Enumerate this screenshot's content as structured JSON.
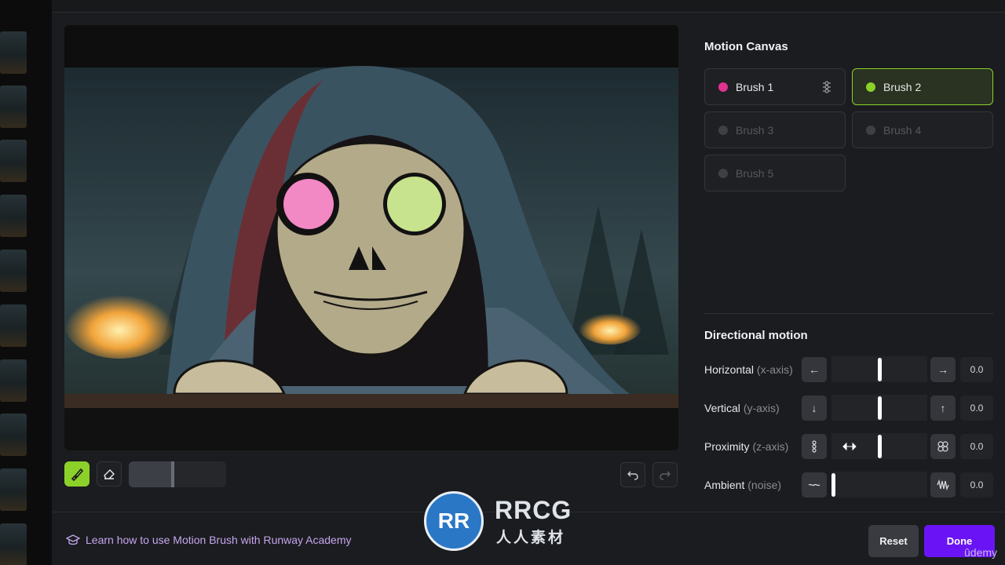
{
  "motion_canvas": {
    "title": "Motion Canvas",
    "brushes": [
      {
        "label": "Brush 1",
        "color": "#e0338f",
        "state": "active"
      },
      {
        "label": "Brush 2",
        "color": "#8bd12a",
        "state": "selected"
      },
      {
        "label": "Brush 3",
        "state": "disabled"
      },
      {
        "label": "Brush 4",
        "state": "disabled"
      },
      {
        "label": "Brush 5",
        "state": "disabled"
      }
    ]
  },
  "directional_motion": {
    "title": "Directional motion",
    "rows": [
      {
        "label": "Horizontal",
        "sub": "(x-axis)",
        "left_icon": "arrow-left-icon",
        "right_icon": "arrow-right-icon",
        "value": "0.0",
        "level": 0.5
      },
      {
        "label": "Vertical",
        "sub": "(y-axis)",
        "left_icon": "arrow-down-icon",
        "right_icon": "arrow-up-icon",
        "value": "0.0",
        "level": 0.5
      },
      {
        "label": "Proximity",
        "sub": "(z-axis)",
        "left_icon": "shrink-icon",
        "right_icon": "expand-icon",
        "value": "0.0",
        "level": 0.5
      },
      {
        "label": "Ambient",
        "sub": "(noise)",
        "left_icon": "wave-flat-icon",
        "right_icon": "wave-icon",
        "value": "0.0",
        "level": 0.0
      }
    ]
  },
  "toolbar": {
    "brush_size_level": 0.45
  },
  "footer": {
    "academy_link": "Learn how to use Motion Brush with Runway Academy",
    "reset_label": "Reset",
    "done_label": "Done"
  },
  "watermark": {
    "brand": "RRCG",
    "subtitle": "人人素材",
    "logo_letters": "RR",
    "udemy": "ûdemy"
  },
  "colors": {
    "accent_green": "#8bd12a",
    "accent_pink": "#e0338f",
    "done_purple": "#6a14f5",
    "link_purple": "#c4a6ef"
  }
}
